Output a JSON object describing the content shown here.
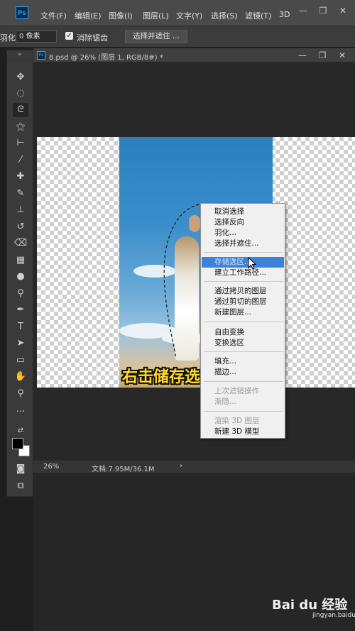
{
  "app": {
    "logo": "Ps"
  },
  "menubar": {
    "items": [
      "文件(F)",
      "编辑(E)",
      "图像(I)",
      "图层(L)",
      "文字(Y)",
      "选择(S)",
      "滤镜(T)",
      "3D"
    ]
  },
  "optionsbar": {
    "feather_label": "羽化:",
    "feather_value": "0 像素",
    "antialias_label": "消除锯齿",
    "select_mask_label": "选择并遮住 ..."
  },
  "document": {
    "title": "8.psd @ 26% (图层 1, RGB/8#) *",
    "zoom": "26%",
    "doc_info": "文档:7.95M/36.1M"
  },
  "caption": "右击储存选区",
  "context_menu": {
    "items": [
      {
        "label": "取消选择",
        "disabled": false
      },
      {
        "label": "选择反向",
        "disabled": false
      },
      {
        "label": "羽化...",
        "disabled": false
      },
      {
        "label": "选择并遮住...",
        "disabled": false
      },
      {
        "label": "存储选区...",
        "disabled": false,
        "highlight": true
      },
      {
        "label": "建立工作路径...",
        "disabled": false
      },
      {
        "label": "通过拷贝的图层",
        "disabled": false
      },
      {
        "label": "通过剪切的图层",
        "disabled": false
      },
      {
        "label": "新建图层...",
        "disabled": false
      },
      {
        "label": "自由变换",
        "disabled": false
      },
      {
        "label": "变换选区",
        "disabled": false
      },
      {
        "label": "填充...",
        "disabled": false
      },
      {
        "label": "描边...",
        "disabled": false
      },
      {
        "label": "上次滤镜操作",
        "disabled": true
      },
      {
        "label": "渐隐...",
        "disabled": true
      },
      {
        "label": "渲染 3D 图层",
        "disabled": true
      },
      {
        "label": "新建 3D 模型",
        "disabled": false
      }
    ]
  },
  "watermark": {
    "logo": "Bai du 经验",
    "url": "jingyan.baidu.com"
  },
  "colors": {
    "highlight": "#3b82d9",
    "caption": "#ffd82a",
    "menubar": "#4a4a4a"
  }
}
